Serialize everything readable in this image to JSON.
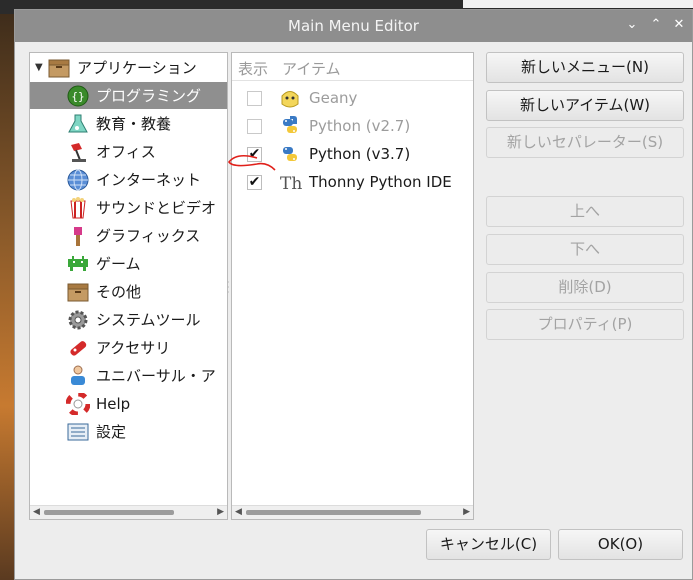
{
  "window": {
    "title": "Main Menu Editor",
    "controls": {
      "minimize": "⌄",
      "maximize": "⌃",
      "close": "✕"
    }
  },
  "categories": {
    "root_label": "アプリケーション",
    "items": [
      {
        "label": "プログラミング",
        "icon": "programming-icon",
        "selected": true
      },
      {
        "label": "教育・教養",
        "icon": "education-icon"
      },
      {
        "label": "オフィス",
        "icon": "office-icon"
      },
      {
        "label": "インターネット",
        "icon": "internet-icon"
      },
      {
        "label": "サウンドとビデオ",
        "icon": "sound-video-icon"
      },
      {
        "label": "グラフィックス",
        "icon": "graphics-icon"
      },
      {
        "label": "ゲーム",
        "icon": "games-icon"
      },
      {
        "label": "その他",
        "icon": "other-icon"
      },
      {
        "label": "システムツール",
        "icon": "system-tools-icon"
      },
      {
        "label": "アクセサリ",
        "icon": "accessories-icon"
      },
      {
        "label": "ユニバーサル・ア",
        "icon": "universal-access-icon"
      },
      {
        "label": "Help",
        "icon": "help-icon"
      },
      {
        "label": "設定",
        "icon": "preferences-icon"
      }
    ]
  },
  "items_panel": {
    "col_show": "表示",
    "col_item": "アイテム",
    "items": [
      {
        "label": "Geany",
        "checked": false,
        "icon": "geany-icon"
      },
      {
        "label": "Python (v2.7)",
        "checked": false,
        "icon": "python-icon"
      },
      {
        "label": "Python (v3.7)",
        "checked": true,
        "icon": "python-icon"
      },
      {
        "label": "Thonny Python IDE",
        "checked": true,
        "icon": "thonny-icon"
      }
    ]
  },
  "buttons": {
    "new_menu": "新しいメニュー(N)",
    "new_item": "新しいアイテム(W)",
    "new_separator": "新しいセパレーター(S)",
    "move_up": "上へ",
    "move_down": "下へ",
    "delete": "削除(D)",
    "properties": "プロパティ(P)",
    "cancel": "キャンセル(C)",
    "ok": "OK(O)"
  },
  "colors": {
    "titlebar": "#8e8e8e",
    "selection": "#8f8f8f",
    "annotation": "#e0201a"
  }
}
